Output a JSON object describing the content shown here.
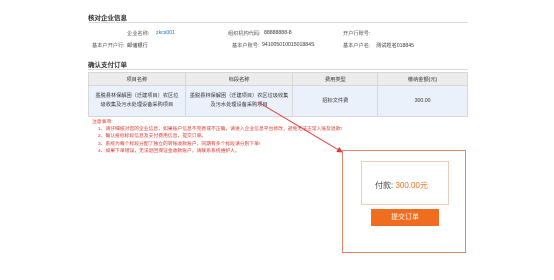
{
  "company_section": {
    "title": "核对企业信息",
    "fields": [
      {
        "label": "企业名称:",
        "value": "zkcs001"
      },
      {
        "label": "组织机构代码:",
        "value": "88888888-8"
      },
      {
        "label": "开户行账号:",
        "value": ""
      },
      {
        "label": "基本户开户行:",
        "value": "邮储银行"
      },
      {
        "label": "基本户账号:",
        "value": "94100501001501884S"
      },
      {
        "label": "基本户户名:",
        "value": "测试姓名018845"
      }
    ]
  },
  "order_section": {
    "title": "确认支付订单",
    "columns": [
      "项目名称",
      "标段名称",
      "费用类型",
      "缴纳金额(元)"
    ],
    "rows": [
      {
        "project": "墨脱县林保解困（迁建项目）农区垃圾收集及污水处理设备采购项目",
        "section": "墨脱县林保解困（迁建项目）农区垃圾收集及污水处理设备采购项目",
        "fee_type": "招标文件费",
        "amount": "300.00"
      }
    ]
  },
  "notice": {
    "title": "注意事项:",
    "items": [
      "1、请仔细核对您的企业信息，如果账户信息不完善或不正确，请进入企业信息平台修改，避免无法正常入账及退款!",
      "2、确认投标标段信息及支付费用信息，提交订单。",
      "3、系统为每个标段分配了独立的转账收款账户，同期有多个标段请分别下单!",
      "4、如果下单错误，无法退回保证金收款账户，请联系系统维护人。"
    ]
  },
  "payment": {
    "label": "付款:",
    "amount": "300.00",
    "unit": "元",
    "submit_label": "提交订单"
  },
  "colors": {
    "accent": "#ef6d1f",
    "notice_red": "#e0352b",
    "link_blue": "#1a6fd0",
    "arrow_red": "#e53935"
  }
}
